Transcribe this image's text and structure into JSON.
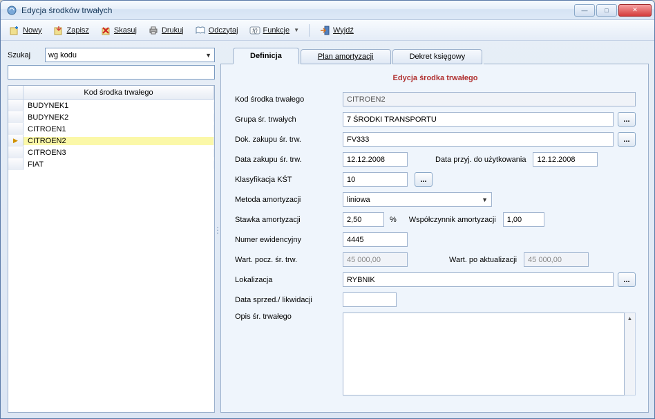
{
  "window": {
    "title": "Edycja środków trwałych"
  },
  "toolbar": {
    "nowy": "Nowy",
    "zapisz": "Zapisz",
    "skasuj": "Skasuj",
    "drukuj": "Drukuj",
    "odczytaj": "Odczytaj",
    "funkcje": "Funkcje",
    "wyjdz": "Wyjdź"
  },
  "search": {
    "label": "Szukaj",
    "mode": "wg kodu"
  },
  "grid": {
    "header": "Kod środka trwałego",
    "rows": [
      {
        "code": "BUDYNEK1"
      },
      {
        "code": "BUDYNEK2"
      },
      {
        "code": "CITROEN1"
      },
      {
        "code": "CITROEN2",
        "selected": true
      },
      {
        "code": "CITROEN3"
      },
      {
        "code": "FIAT"
      }
    ]
  },
  "tabs": {
    "definicja": "Definicja",
    "plan": "Plan amortyzacji",
    "dekret": "Dekret księgowy"
  },
  "form": {
    "title": "Edycja środka trwałego",
    "labels": {
      "kod": "Kod środka trwałego",
      "grupa": "Grupa śr. trwałych",
      "dok": "Dok. zakupu śr. trw.",
      "data_zak": "Data zakupu śr. trw.",
      "data_uzyt": "Data przyj. do użytkowania",
      "klas": "Klasyfikacja KŚT",
      "metoda": "Metoda amortyzacji",
      "stawka": "Stawka amortyzacji",
      "pct": "%",
      "wspol": "Współczynnik amortyzacji",
      "numer": "Numer ewidencyjny",
      "wart_pocz": "Wart. pocz. śr. trw.",
      "wart_akt": "Wart. po aktualizacji",
      "lokal": "Lokalizacja",
      "data_likw": "Data sprzed./ likwidacji",
      "opis": "Opis śr. trwałego"
    },
    "values": {
      "kod": "CITROEN2",
      "grupa": "7 ŚRODKI TRANSPORTU",
      "dok": "FV333",
      "data_zak": "12.12.2008",
      "data_uzyt": "12.12.2008",
      "klas": "10",
      "metoda": "liniowa",
      "stawka": "2,50",
      "wspol": "1,00",
      "numer": "4445",
      "wart_pocz": "45 000,00",
      "wart_akt": "45 000,00",
      "lokal": "RYBNIK",
      "data_likw": "",
      "opis": ""
    }
  }
}
